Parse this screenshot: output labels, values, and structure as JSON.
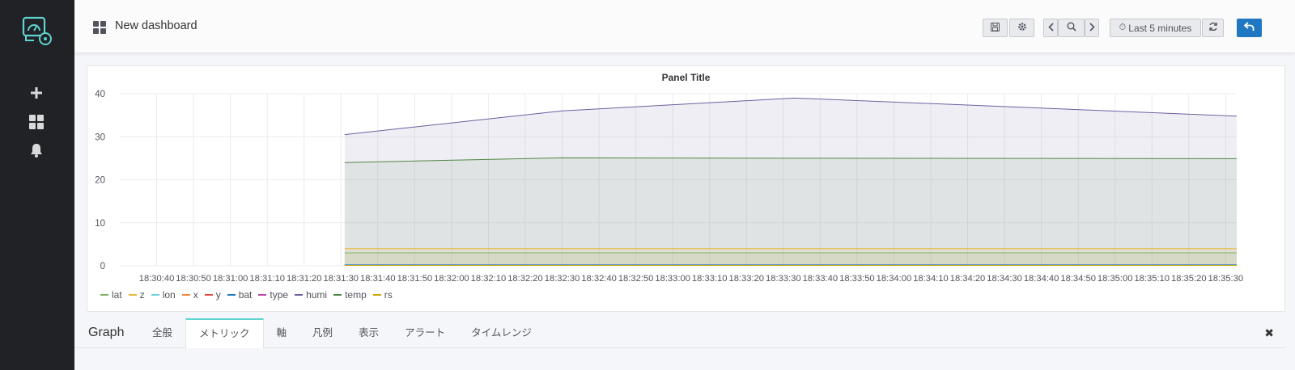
{
  "sidebar": {
    "logo_icon": "grafana-logo-icon",
    "items": [
      {
        "icon": "plus-icon",
        "label": "+"
      },
      {
        "icon": "dashboards-icon"
      },
      {
        "icon": "bell-icon"
      }
    ]
  },
  "topbar": {
    "title": "New dashboard",
    "time_range": "Last 5 minutes",
    "buttons": [
      "save-icon",
      "gear-icon",
      "chevron-left-icon",
      "zoom-out-icon",
      "chevron-right-icon",
      "refresh-icon",
      "back-icon"
    ],
    "clock_glyph": "⏱"
  },
  "panel": {
    "title": "Panel Title"
  },
  "chart_data": {
    "type": "area",
    "title": "Panel Title",
    "ylim": [
      0,
      40
    ],
    "y_ticks": [
      "0",
      "10",
      "20",
      "30",
      "40"
    ],
    "x_tick_labels": [
      "18:30:40",
      "18:30:50",
      "18:31:00",
      "18:31:10",
      "18:31:20",
      "18:31:30",
      "18:31:40",
      "18:31:50",
      "18:32:00",
      "18:32:10",
      "18:32:20",
      "18:32:30",
      "18:32:40",
      "18:32:50",
      "18:33:00",
      "18:33:10",
      "18:33:20",
      "18:33:30",
      "18:33:40",
      "18:33:50",
      "18:34:00",
      "18:34:10",
      "18:34:20",
      "18:34:30",
      "18:34:40",
      "18:34:50",
      "18:35:00",
      "18:35:10",
      "18:35:20",
      "18:35:30"
    ],
    "x": [
      "18:31:31",
      "18:32:30",
      "18:33:33",
      "18:35:33"
    ],
    "x_seconds": [
      91,
      150,
      213,
      333
    ],
    "x_range_seconds": [
      30,
      333
    ],
    "grid": true,
    "legend_position": "bottom",
    "series": [
      {
        "name": "lat",
        "color": "#7eb26d",
        "values": [
          3.0,
          3.0,
          3.0,
          3.0
        ]
      },
      {
        "name": "z",
        "color": "#eab839",
        "values": [
          4.0,
          4.0,
          4.0,
          4.0
        ]
      },
      {
        "name": "lon",
        "color": "#6ed0e0",
        "values": [
          0.2,
          0.2,
          0.2,
          0.2
        ]
      },
      {
        "name": "x",
        "color": "#ef843c",
        "values": [
          0.1,
          0.1,
          0.1,
          0.1
        ]
      },
      {
        "name": "y",
        "color": "#e24d42",
        "values": [
          0.1,
          0.1,
          0.1,
          0.1
        ]
      },
      {
        "name": "bat",
        "color": "#1f78c1",
        "values": [
          0.2,
          0.2,
          0.2,
          0.2
        ]
      },
      {
        "name": "type",
        "color": "#ba43a9",
        "values": [
          0.1,
          0.1,
          0.1,
          0.1
        ]
      },
      {
        "name": "humi",
        "color": "#705da0",
        "values": [
          30.5,
          36,
          39,
          34.8
        ]
      },
      {
        "name": "temp",
        "color": "#508642",
        "values": [
          24,
          25.1,
          25,
          24.9
        ]
      },
      {
        "name": "rs",
        "color": "#cca300",
        "values": [
          0.1,
          0.1,
          0.1,
          0.1
        ]
      }
    ]
  },
  "editor": {
    "panel_type": "Graph",
    "tabs": [
      "全般",
      "メトリック",
      "軸",
      "凡例",
      "表示",
      "アラート",
      "タイムレンジ"
    ],
    "active_tab": "メトリック",
    "close_label": "✖"
  }
}
